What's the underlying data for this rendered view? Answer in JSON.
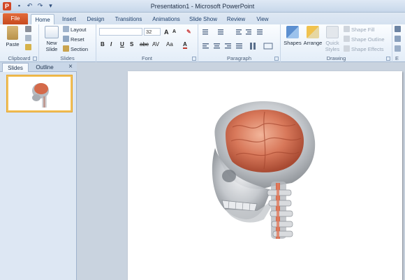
{
  "window": {
    "title": "Presentation1 - Microsoft PowerPoint",
    "app_icon_letter": "P"
  },
  "tabs": {
    "file": "File",
    "items": [
      "Home",
      "Insert",
      "Design",
      "Transitions",
      "Animations",
      "Slide Show",
      "Review",
      "View"
    ],
    "active": "Home"
  },
  "ribbon": {
    "clipboard": {
      "label": "Clipboard",
      "paste": "Paste"
    },
    "slides": {
      "label": "Slides",
      "new_slide_1": "New",
      "new_slide_2": "Slide",
      "layout": "Layout",
      "reset": "Reset",
      "section": "Section"
    },
    "font": {
      "label": "Font",
      "size": "32",
      "bold": "B",
      "italic": "I",
      "underline": "U",
      "strike": "S",
      "abc": "abc",
      "av": "AV",
      "aa": "Aa",
      "grow": "A",
      "shrink": "A",
      "color": "A"
    },
    "paragraph": {
      "label": "Paragraph"
    },
    "drawing": {
      "label": "Drawing",
      "shapes": "Shapes",
      "arrange": "Arrange",
      "quick_styles_1": "Quick",
      "quick_styles_2": "Styles",
      "shape_fill": "Shape Fill",
      "shape_outline": "Shape Outline",
      "shape_effects": "Shape Effects",
      "edit_label": "E"
    }
  },
  "pane": {
    "tab_slides": "Slides",
    "tab_outline": "Outline",
    "close": "×",
    "slide_number": "1"
  },
  "colors": {
    "file_tab": "#d04a22",
    "selection": "#f2c15a"
  }
}
